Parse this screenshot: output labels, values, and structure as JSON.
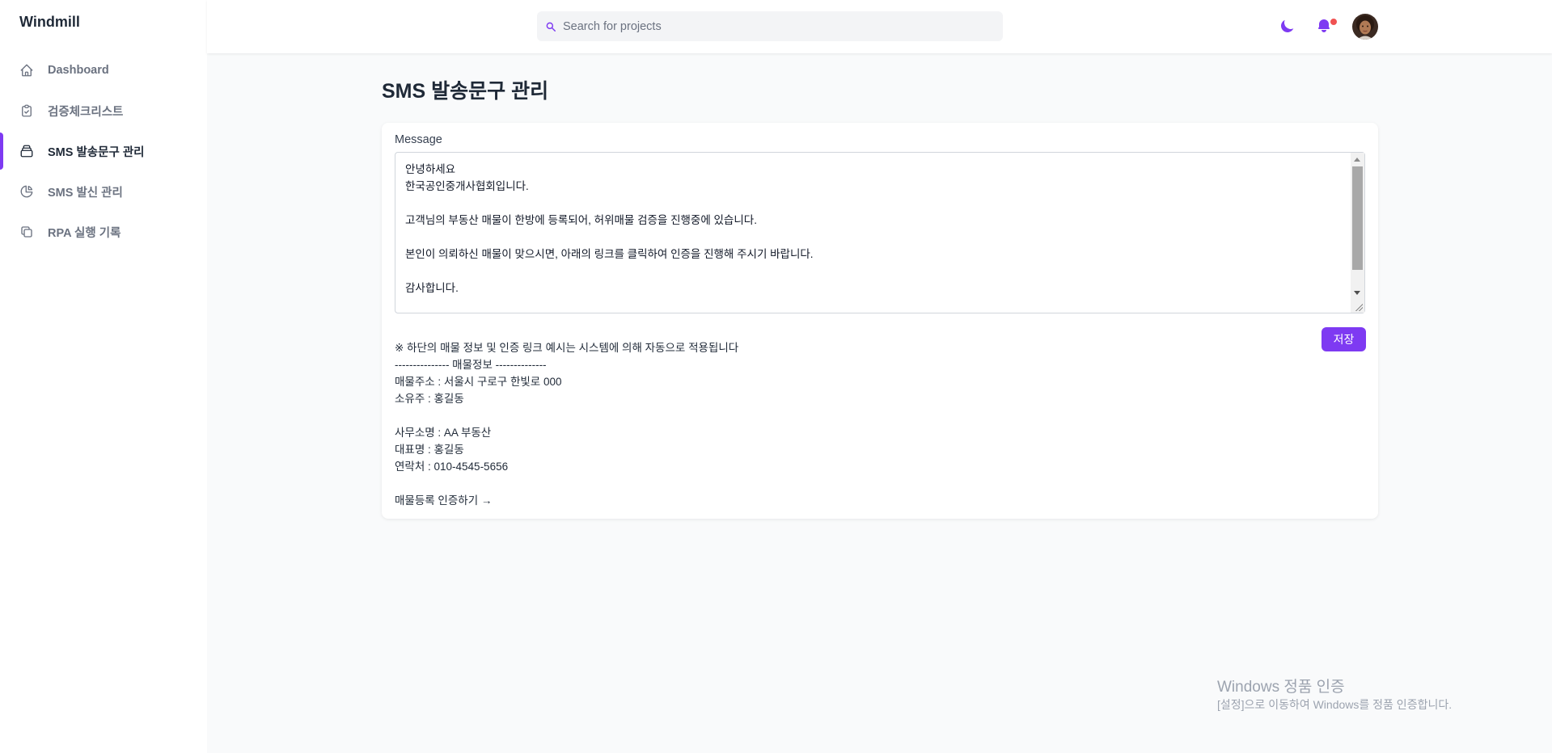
{
  "app": {
    "brand": "Windmill"
  },
  "sidebar": {
    "items": [
      {
        "label": "Dashboard",
        "icon": "home-icon",
        "active": false
      },
      {
        "label": "검증체크리스트",
        "icon": "clipboard-icon",
        "active": false
      },
      {
        "label": "SMS 발송문구 관리",
        "icon": "archive-icon",
        "active": true
      },
      {
        "label": "SMS 발신 관리",
        "icon": "pie-chart-icon",
        "active": false
      },
      {
        "label": "RPA 실행 기록",
        "icon": "copy-icon",
        "active": false
      }
    ]
  },
  "header": {
    "search_placeholder": "Search for projects",
    "theme_icon": "moon-icon",
    "notification_icon": "bell-icon",
    "notification_dot_color": "#f05252"
  },
  "main": {
    "title": "SMS 발송문구 관리",
    "message_label": "Message",
    "message_value": "안녕하세요\n한국공인중개사협회입니다.\n\n고객님의 부동산 매물이 한방에 등록되어, 허위매물 검증을 진행중에 있습니다.\n\n본인이 의뢰하신 매물이 맞으시면, 아래의 링크를 클릭하여 인증을 진행해 주시기 바랍니다.\n\n감사합니다.",
    "save_label": "저장",
    "preview_text": "※ 하단의 매물 정보 및 인증 링크 예시는 시스템에 의해 자동으로 적용됩니다\n--------------- 매물정보 --------------\n매물주소 : 서울시 구로구 한빛로 000\n소유주 : 홍길동\n\n사무소명 : AA 부동산\n대표명 : 홍길동\n연락처 : 010-4545-5656\n\n매물등록 인증하기 →"
  },
  "watermark": {
    "title": "Windows 정품 인증",
    "subtitle": "[설정]으로 이동하여 Windows를 정품 인증합니다."
  },
  "colors": {
    "accent": "#7e3af2",
    "background": "#f9fafb"
  }
}
